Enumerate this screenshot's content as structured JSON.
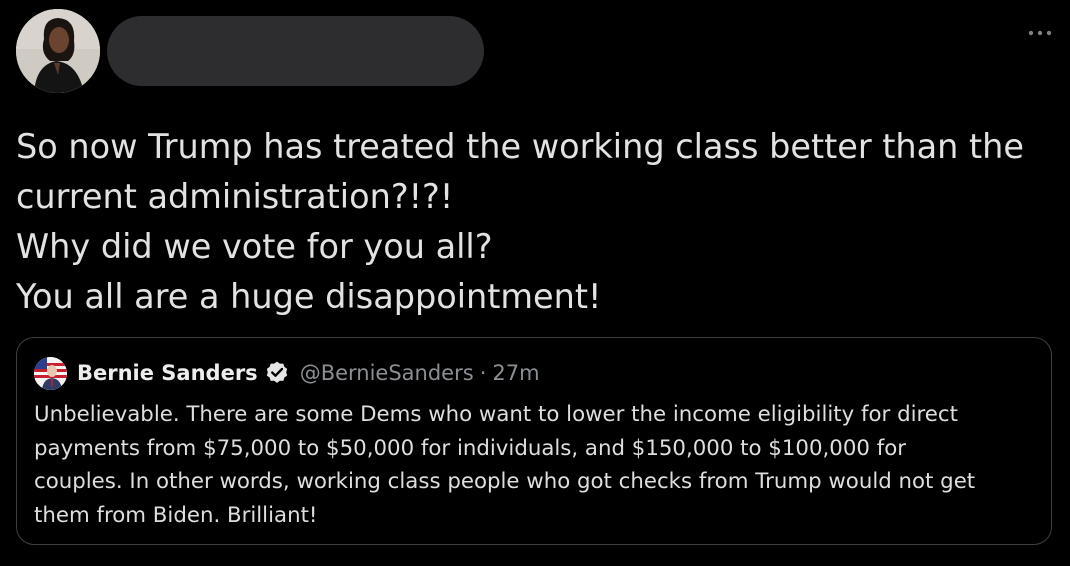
{
  "tweet": {
    "lines": [
      "So now Trump has treated the working class better than the",
      "current administration?!?!",
      "Why did we vote for you all?",
      "You all are a huge disappointment!"
    ],
    "more_icon": "more-horizontal-icon"
  },
  "quote": {
    "author_name": "Bernie Sanders",
    "verified_icon": "verified-badge-icon",
    "handle": "@BernieSanders",
    "separator": "·",
    "time": "27m",
    "lines": [
      "Unbelievable. There are some Dems who want to lower the income eligibility for direct",
      "payments from $75,000 to $50,000 for individuals, and $150,000 to $100,000 for",
      "couples. In other words, working class people who got checks from Trump would not get",
      "them from Biden. Brilliant!"
    ]
  },
  "colors": {
    "background": "#000000",
    "text": "#e2e2e2",
    "muted": "#8b8f94",
    "border": "#3c3f43",
    "redaction": "#2d2d2f"
  }
}
